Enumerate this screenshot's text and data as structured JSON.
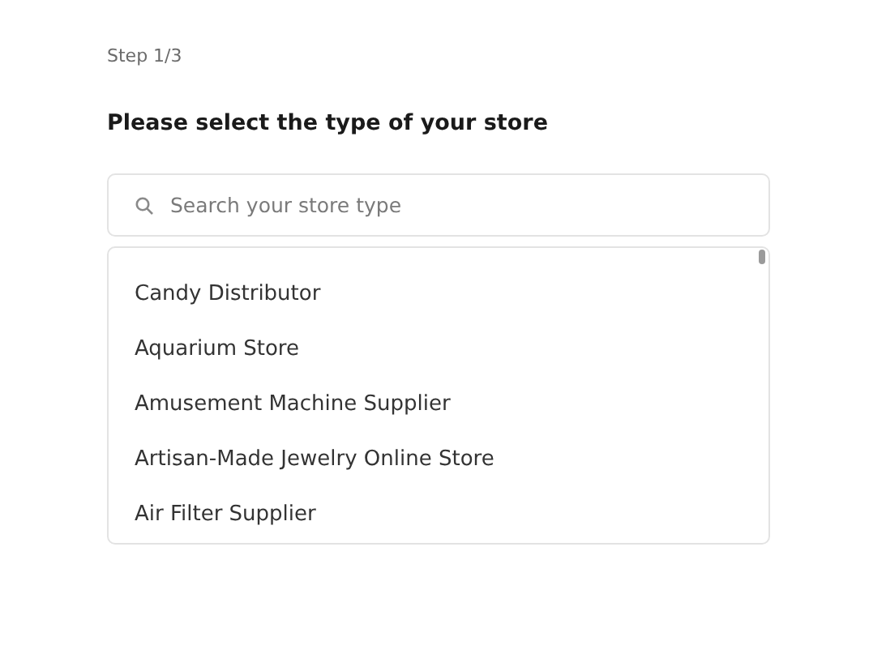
{
  "step": "Step 1/3",
  "title": "Please select the type of your store",
  "search": {
    "placeholder": "Search your store type"
  },
  "options": [
    {
      "label": "Candy Distributor"
    },
    {
      "label": "Aquarium Store"
    },
    {
      "label": "Amusement Machine Supplier"
    },
    {
      "label": "Artisan-Made Jewelry Online Store"
    },
    {
      "label": "Air Filter Supplier"
    }
  ]
}
